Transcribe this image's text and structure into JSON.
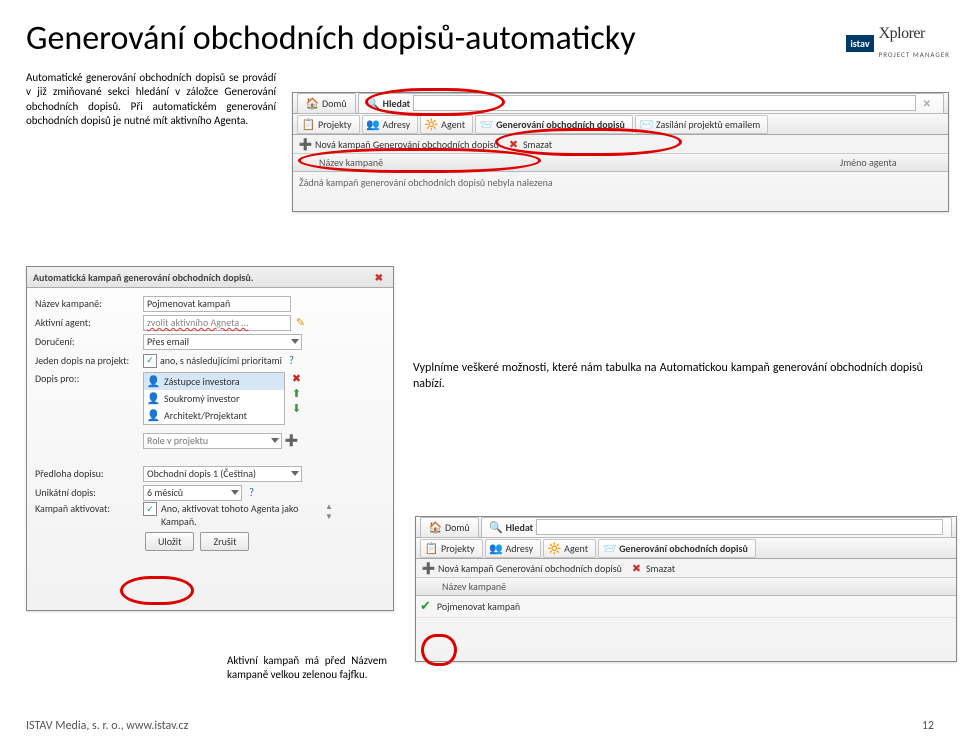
{
  "brand": {
    "badge": "istav",
    "name": "Xplorer",
    "sub": "PROJECT MANAGER"
  },
  "title": "Generování obchodních dopisů-automaticky",
  "intro": "Automatické generování obchodních dopisů se provádí v již zmiňované sekci hledání v záložce Generování obchodních dopisů. Při automatickém generování obchodních dopisů je nutné mít aktivního Agenta.",
  "mid": "Vyplníme veškeré možnosti, které nám tabulka na Automatickou kampaň generování obchodních dopisů nabízí.",
  "bot": "Aktivní kampaň má před Názvem kampaně velkou zelenou fajfku.",
  "footer_left": "ISTAV Media, s. r. o., www.istav.cz",
  "footer_right": "12",
  "top_panel": {
    "tabs": {
      "home": "Domů",
      "search": "Hledat"
    },
    "toolbar": {
      "projekty": "Projekty",
      "adresy": "Adresy",
      "agent": "Agent",
      "gen": "Generování obchodních dopisů",
      "zasilani": "Zasílání projektů emailem"
    },
    "subbar": {
      "nova": "Nová kampaň Generování obchodních dopisů",
      "smazat": "Smazat"
    },
    "thead": {
      "nazev": "Název kampaně",
      "agent": "Jméno agenta"
    },
    "empty": "Žádná kampaň generování obchodních dopisů nebyla nalezena"
  },
  "form": {
    "title": "Automatická kampaň generování obchodních dopisů.",
    "labels": {
      "nazev": "Název kampaně:",
      "agent": "Aktivní agent:",
      "doruceni": "Doručení:",
      "jeden": "Jeden dopis na projekt:",
      "dopispro": "Dopis pro::",
      "role": "Role v projektu",
      "predloha": "Předloha dopisu:",
      "unikatni": "Unikátní dopis:",
      "aktivovat": "Kampaň aktivovat:"
    },
    "values": {
      "nazev": "Pojmenovat kampaň",
      "agent": "zvolit aktivního Agneta …",
      "doruceni": "Přes email",
      "jeden": "ano, s následujícími prioritami",
      "list": [
        "Zástupce investora",
        "Soukromý investor",
        "Architekt/Projektant"
      ],
      "predloha": "Obchodní dopis 1 (Čeština)",
      "unikatni": "6 měsíců",
      "aktivovat": "Ano, aktivovat tohoto Agenta jako Kampaň."
    },
    "buttons": {
      "save": "Uložit",
      "cancel": "Zrušit"
    }
  },
  "bot_panel": {
    "tabs": {
      "home": "Domů",
      "search": "Hledat"
    },
    "toolbar": {
      "projekty": "Projekty",
      "adresy": "Adresy",
      "agent": "Agent",
      "gen": "Generování obchodních dopisů"
    },
    "subbar": {
      "nova": "Nová kampaň Generování obchodních dopisů",
      "smazat": "Smazat"
    },
    "thead": {
      "nazev": "Název kampaně"
    },
    "row": {
      "name": "Pojmenovat kampaň"
    }
  }
}
